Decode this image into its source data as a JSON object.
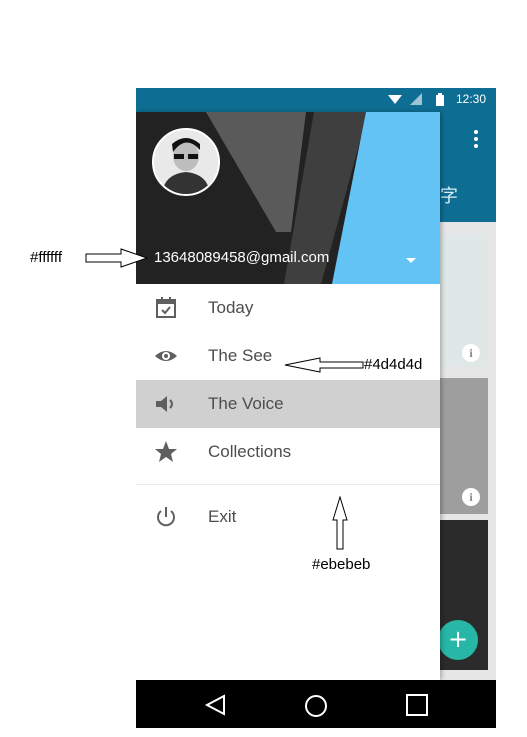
{
  "status_bar": {
    "time": "12:30"
  },
  "app_bar": {
    "partial_title": "字"
  },
  "drawer": {
    "header": {
      "email": "13648089458@gmail.com"
    },
    "menu": [
      {
        "label": "Today",
        "icon": "calendar-check-icon"
      },
      {
        "label": "The See",
        "icon": "eye-icon"
      },
      {
        "label": "The Voice",
        "icon": "volume-icon",
        "active": true
      },
      {
        "label": "Collections",
        "icon": "star-icon"
      },
      {
        "label": "Exit",
        "icon": "power-icon"
      }
    ]
  },
  "annotations": {
    "email_color": "#ffffff",
    "text_color": "#4d4d4d",
    "divider_color": "#ebebeb"
  },
  "colors": {
    "primary": "#0e6d92",
    "header_accent": "#64c3f5",
    "fab": "#26b7a6",
    "active_item": "#d0d0d0"
  }
}
